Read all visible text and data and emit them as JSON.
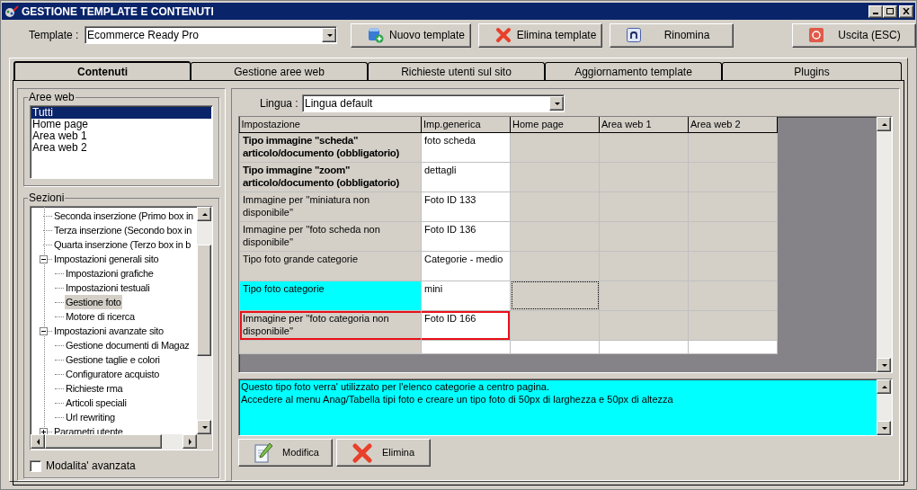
{
  "window": {
    "title": "GESTIONE TEMPLATE E CONTENUTI"
  },
  "toolbar": {
    "template_label": "Template :",
    "template_value": "Ecommerce Ready Pro",
    "buttons": [
      {
        "label": "Nuovo template",
        "kind": "new"
      },
      {
        "label": "Elimina template",
        "kind": "delete"
      },
      {
        "label": "Rinomina",
        "kind": "rename"
      },
      {
        "label": "Uscita (ESC)",
        "kind": "exit"
      }
    ]
  },
  "tabs": [
    {
      "label": "Contenuti",
      "selected": true
    },
    {
      "label": "Gestione aree web",
      "selected": false
    },
    {
      "label": "Richieste utenti sul sito",
      "selected": false
    },
    {
      "label": "Aggiornamento template",
      "selected": false
    },
    {
      "label": "Plugins",
      "selected": false
    }
  ],
  "aree_web": {
    "title": "Aree web",
    "items": [
      {
        "label": "Tutti",
        "selected": true
      },
      {
        "label": "Home page",
        "selected": false
      },
      {
        "label": "Area web 1",
        "selected": false
      },
      {
        "label": "Area web 2",
        "selected": false
      }
    ]
  },
  "sezioni": {
    "title": "Sezioni",
    "items": [
      {
        "label": "Seconda inserzione (Primo box in",
        "selected": false
      },
      {
        "label": "Terza inserzione (Secondo box in",
        "selected": false
      },
      {
        "label": "Quarta inserzione (Terzo box in b",
        "selected": false
      },
      {
        "label": "Impostazioni generali sito",
        "selected": false,
        "expanded": true,
        "children": [
          {
            "label": "Impostazioni grafiche",
            "selected": false
          },
          {
            "label": "Impostazioni testuali",
            "selected": false
          },
          {
            "label": "Gestione foto",
            "selected": true
          },
          {
            "label": "Motore di ricerca",
            "selected": false
          }
        ]
      },
      {
        "label": "Impostazioni avanzate sito",
        "selected": false,
        "expanded": true,
        "children": [
          {
            "label": "Gestione documenti di Magaz",
            "selected": false
          },
          {
            "label": "Gestione taglie e colori",
            "selected": false
          },
          {
            "label": "Configuratore acquisto",
            "selected": false
          },
          {
            "label": "Richieste rma",
            "selected": false
          },
          {
            "label": "Articoli speciali",
            "selected": false
          },
          {
            "label": "Url rewriting",
            "selected": false
          }
        ]
      },
      {
        "label": "Parametri utente",
        "selected": false,
        "expanded": false
      }
    ],
    "advanced_mode": {
      "label": "Modalita' avanzata",
      "checked": false
    }
  },
  "lingua": {
    "label": "Lingua :",
    "value": "Lingua default"
  },
  "table": {
    "columns": [
      "Impostazione",
      "Imp.generica",
      "Home page",
      "Area web 1",
      "Area web 2"
    ],
    "rows": [
      {
        "label": "Tipo immagine \"scheda\" articolo/documento (obbligatorio)",
        "value": "foto scheda",
        "required": true,
        "selected": false,
        "highlighted": false
      },
      {
        "label": "Tipo immagine \"zoom\" articolo/documento (obbligatorio)",
        "value": "dettagli",
        "required": true,
        "selected": false,
        "highlighted": false
      },
      {
        "label": "Immagine per ''miniatura non disponibile''",
        "value": "Foto ID 133",
        "required": false,
        "selected": false,
        "highlighted": false
      },
      {
        "label": "Immagine per ''foto scheda non disponibile''",
        "value": "Foto ID 136",
        "required": false,
        "selected": false,
        "highlighted": false
      },
      {
        "label": "Tipo foto grande categorie",
        "value": "Categorie - medio",
        "required": false,
        "selected": false,
        "highlighted": false
      },
      {
        "label": "Tipo foto categorie",
        "value": "mini",
        "required": false,
        "selected": true,
        "highlighted": false
      },
      {
        "label": "Immagine per ''foto categoria non disponibile''",
        "value": "Foto ID 166",
        "required": false,
        "selected": false,
        "highlighted": true
      }
    ]
  },
  "description": {
    "lines": [
      "Questo tipo foto verra' utilizzato per l'elenco categorie a centro pagina.",
      "Accedere al menu Anag/Tabella tipi foto e creare un tipo foto di 50px di larghezza e 50px di altezza"
    ]
  },
  "actions": [
    {
      "label": "Modifica",
      "kind": "edit"
    },
    {
      "label": "Elimina",
      "kind": "delete"
    }
  ]
}
